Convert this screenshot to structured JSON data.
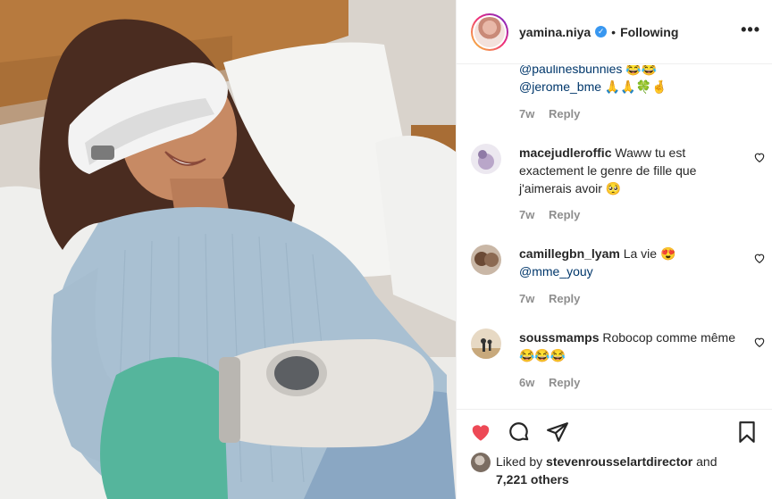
{
  "header": {
    "username": "yamina.niya",
    "verified_glyph": "✓",
    "separator": "•",
    "follow_status": "Following",
    "more_glyph": "•••"
  },
  "comments": {
    "continued": {
      "line1": "@paulinesbunnies 😂😂",
      "line2": "@jerome_bme 🙏🙏🍀🤞",
      "age": "7w",
      "reply": "Reply"
    },
    "items": [
      {
        "user": "macejudleroffic",
        "text": "Waww tu est exactement le genre de fille que j'aimerais avoir 🥺",
        "age": "7w",
        "reply": "Reply"
      },
      {
        "user": "camillegbn_lyam",
        "text": "La vie 😍",
        "mention": "@mme_youy",
        "age": "7w",
        "reply": "Reply"
      },
      {
        "user": "soussmamps",
        "text": "Robocop comme même 😂😂😂",
        "age": "6w",
        "reply": "Reply"
      }
    ]
  },
  "actions": {
    "icons": [
      "heart-filled-icon",
      "comment-icon",
      "share-icon",
      "bookmark-icon"
    ],
    "like_color": "#ed4956",
    "liked_by_prefix": "Liked by",
    "liked_by_user": "stevenrousselartdirector",
    "liked_by_and": "and",
    "likes_count": "7,221 others"
  },
  "colors": {
    "mention": "#00376b",
    "meta_gray": "#8e8e8e",
    "verified_blue": "#3897f0"
  }
}
